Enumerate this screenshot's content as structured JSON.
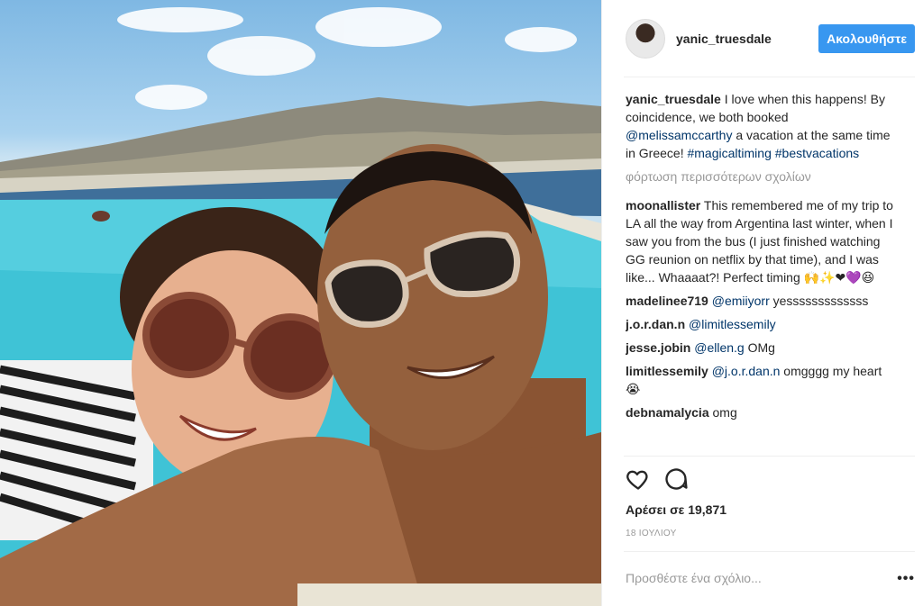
{
  "header": {
    "username": "yanic_truesdale",
    "follow_label": "Ακολουθήστε"
  },
  "caption": {
    "user": "yanic_truesdale",
    "text_1": " I love when this happens! By coincidence, we both booked ",
    "mention": "@melissamccarthy",
    "text_2": " a vacation at the same time in Greece! ",
    "hashtag_1": "#magicaltiming",
    "hashtag_2": "#bestvacations"
  },
  "load_more_label": "φόρτωση περισσότερων σχολίων",
  "comments": [
    {
      "user": "moonallister",
      "text": " This remembered me of my trip to LA all the way from Argentina last winter, when I saw you from the bus (I just finished watching GG reunion on netflix by that time), and I was like... Whaaaat?! Perfect timing 🙌✨❤💜😆"
    },
    {
      "user": "madelinee719",
      "mention": "@emiiyorr",
      "text": " yesssssssssssss"
    },
    {
      "user": "j.o.r.dan.n",
      "mention": "@limitlessemily",
      "text": ""
    },
    {
      "user": "jesse.jobin",
      "mention": "@ellen.g",
      "text": " OMg"
    },
    {
      "user": "limitlessemily",
      "mention": "@j.o.r.dan.n",
      "text": " omgggg my heart 😭"
    },
    {
      "user": "debnamalycia",
      "text": " omg"
    }
  ],
  "likes_label": "Αρέσει σε 19,871",
  "date_label": "18 ΙΟΥΛΙΟΥ",
  "add_comment_placeholder": "Προσθέστε ένα σχόλιο...",
  "more_label": "•••",
  "icons": {
    "like": "heart-outline-icon",
    "comment": "speech-bubble-icon",
    "more": "ellipsis-icon"
  },
  "colors": {
    "follow_button": "#3897f0",
    "link": "#003569",
    "muted": "#999999"
  }
}
